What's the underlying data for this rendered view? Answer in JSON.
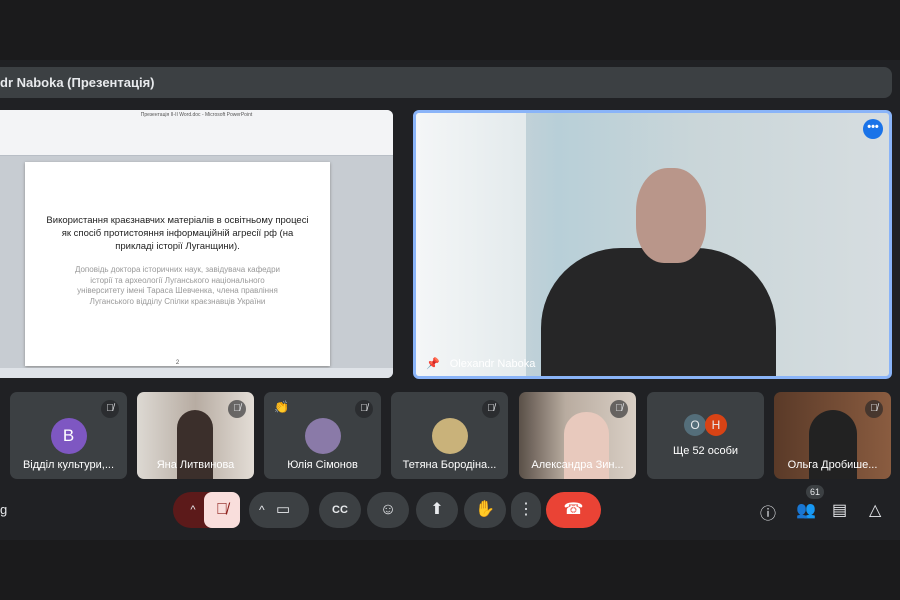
{
  "header": {
    "title": "dr Naboka (Презентація)"
  },
  "presentation": {
    "window_title": "Презентація ІІ-ІІ Word.doc - Microsoft PowerPoint",
    "slide_title": "Використання краєзнавчих матеріалів в освітньому процесі як спосіб протистояння інформаційній агресії рф (на прикладі історії Луганщини).",
    "slide_subtitle": "Доповідь доктора історичних наук, завідувача кафедри історії та археології Луганського національного університету імені Тараса Шевченка, члена правління Луганського відділу Спілки краєзнавців України",
    "page_number": "2"
  },
  "speaker": {
    "name": "Olexandr Naboka"
  },
  "participants": [
    {
      "name": "Відділ культури,...",
      "avatar": "В",
      "color": "#7e57c2"
    },
    {
      "name": "Яна Литвинова"
    },
    {
      "name": "Юлія Сімонов"
    },
    {
      "name": "Тетяна Бородіна..."
    },
    {
      "name": "Александра Зин..."
    },
    {
      "name": "Ще 52 особи",
      "avatars": [
        "О",
        "Н"
      ],
      "colors": [
        "#546e7a",
        "#d84315"
      ]
    },
    {
      "name": "Ольга Дробише..."
    }
  ],
  "controls": {
    "meeting_code": "g",
    "people_count": "61",
    "end_call_color": "#ea4335"
  }
}
